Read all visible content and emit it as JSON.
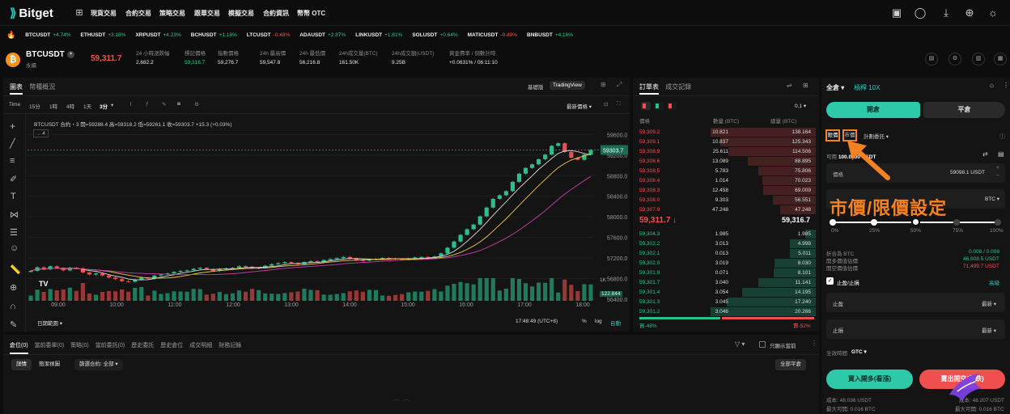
{
  "nav": {
    "brand": "Bitget",
    "items": [
      "現貨交易",
      "合約交易",
      "策略交易",
      "跟單交易",
      "模擬交易",
      "合約資訊",
      "幣幣 OTC"
    ]
  },
  "ticker": [
    {
      "sym": "BTCUSDT",
      "chg": "+4.74%",
      "dir": "up"
    },
    {
      "sym": "ETHUSDT",
      "chg": "+3.18%",
      "dir": "up"
    },
    {
      "sym": "XRPUSDT",
      "chg": "+4.23%",
      "dir": "up"
    },
    {
      "sym": "BCHUSDT",
      "chg": "+1.18%",
      "dir": "up"
    },
    {
      "sym": "LTCUSDT",
      "chg": "-0.48%",
      "dir": "dn"
    },
    {
      "sym": "ADAUSDT",
      "chg": "+2.87%",
      "dir": "up"
    },
    {
      "sym": "LINKUSDT",
      "chg": "+1.81%",
      "dir": "up"
    },
    {
      "sym": "SOLUSDT",
      "chg": "+0.64%",
      "dir": "up"
    },
    {
      "sym": "MATICUSDT",
      "chg": "-0.49%",
      "dir": "dn"
    },
    {
      "sym": "BNBUSDT",
      "chg": "+4.16%",
      "dir": "up"
    }
  ],
  "pair": {
    "name": "BTCUSDT",
    "type": "永續",
    "coin_letter": "₿",
    "price": "59,311.7",
    "stats": [
      {
        "label": "24 小時漲跌幅",
        "value": "2,682.2",
        "sub": "+4.74%"
      },
      {
        "label": "標記價格",
        "value": "59,316.7"
      },
      {
        "label": "指數價格",
        "value": "59,276.7"
      },
      {
        "label": "24h 最高價",
        "value": "59,547.8"
      },
      {
        "label": "24h 最低價",
        "value": "56,216.8"
      },
      {
        "label": "24h成交量(BTC)",
        "value": "161.50K"
      },
      {
        "label": "24h成交額(USDT)",
        "value": "9.25B"
      },
      {
        "label": "資金費率 / 倒數計時",
        "value": "+0.0631% / 06:11:10"
      }
    ]
  },
  "chart": {
    "tabs": [
      "圖表",
      "幣種概況"
    ],
    "modes": [
      "基礎版",
      "TradingView"
    ],
    "intervals": [
      "Time",
      "15分",
      "1時",
      "4時",
      "1天",
      "3分"
    ],
    "price_type": "最新價格",
    "legend": "BTCUSDT 合約・3  開=59288.4 高=59318.2 低=59261.1 收=59303.7 +15.3 (+0.03%)",
    "indicator_count": "4",
    "current_price_label": "59303.7",
    "volume_label": "122.844",
    "vol_axis_label": "1K",
    "time_display": "17:48:49 (UTC+8)",
    "date_range": "日期範圍",
    "pct": "%",
    "log": "log",
    "auto": "自動"
  },
  "chart_data": {
    "type": "candlestick",
    "y_ticks": [
      "59600.0",
      "59200.0",
      "58800.0",
      "58400.0",
      "58000.0",
      "57600.0",
      "57200.0",
      "56800.0",
      "56400.0"
    ],
    "ylim": [
      56400,
      59700
    ],
    "x_ticks": [
      "09:00",
      "10:00",
      "11:00",
      "12:00",
      "13:00",
      "14:00",
      "15:00",
      "16:00",
      "17:00",
      "18:00"
    ],
    "close": [
      56950,
      57020,
      56980,
      57040,
      57000,
      56960,
      57010,
      57000,
      56920,
      56880,
      56900,
      56860,
      56820,
      56790,
      56750,
      56740,
      56780,
      56820,
      56800,
      56860,
      56880,
      56900,
      56930,
      56950,
      56960,
      56990,
      57010,
      56980,
      56950,
      56990,
      57000,
      57010,
      57040,
      57030,
      57000,
      57010,
      57050,
      57080,
      57100,
      57120,
      57100,
      57080,
      57120,
      57140,
      57130,
      57160,
      57180,
      57200,
      57220,
      57190,
      57160,
      57150,
      57170,
      57180,
      57200,
      57190,
      57180,
      57170,
      57190,
      57210,
      57220,
      57210,
      57230,
      57290,
      57400,
      57520,
      57650,
      57760,
      57850,
      58010,
      58180,
      58350,
      58420,
      58500,
      58680,
      58840,
      58950,
      59020,
      59120,
      59210,
      59380,
      59430,
      59260,
      59150,
      59110,
      59210,
      59300
    ]
  },
  "orderbook": {
    "tabs": [
      "訂單表",
      "成交記錄"
    ],
    "precision": "0.1",
    "headers": [
      "價格",
      "數量 (BTC)",
      "總量 (BTC)"
    ],
    "asks": [
      [
        "59,309.2",
        "10.821",
        "138.164"
      ],
      [
        "59,309.1",
        "10.837",
        "125.343"
      ],
      [
        "59,308.9",
        "25.611",
        "114.506"
      ],
      [
        "59,308.6",
        "13.089",
        "88.895"
      ],
      [
        "59,308.5",
        "5.783",
        "75.806"
      ],
      [
        "59,308.4",
        "1.014",
        "70.023"
      ],
      [
        "59,308.3",
        "12.458",
        "69.009"
      ],
      [
        "59,308.0",
        "9.303",
        "56.551"
      ],
      [
        "59,307.9",
        "47.248",
        "47.248"
      ]
    ],
    "mid_price": "59,311.7 ↓",
    "mark": "59,316.7",
    "bids": [
      [
        "59,304.3",
        "1.985",
        "1.985"
      ],
      [
        "59,302.2",
        "3.013",
        "4.998"
      ],
      [
        "59,302.1",
        "0.013",
        "5.011"
      ],
      [
        "59,302.0",
        "3.019",
        "8.030"
      ],
      [
        "59,301.9",
        "0.071",
        "8.101"
      ],
      [
        "59,301.7",
        "3.040",
        "11.141"
      ],
      [
        "59,301.4",
        "3.054",
        "14.195"
      ],
      [
        "59,301.3",
        "3.045",
        "17.240"
      ],
      [
        "59,301.2",
        "3.046",
        "20.286"
      ]
    ],
    "buy_ratio": "買-48%",
    "sell_ratio": "賣-52%"
  },
  "trade": {
    "margin_mode": "全倉",
    "leverage": "槓桿 10X",
    "open": "開倉",
    "close": "平倉",
    "order_types": [
      "限價",
      "市價",
      "計劃委託"
    ],
    "avail_label": "可用",
    "avail_value": "100.0000 USDT",
    "price_label": "價格",
    "price_value": "59098.1 USDT",
    "qty_unit": "BTC",
    "annotation": "市價/限價設定",
    "slider": [
      "0%",
      "25%",
      "50%",
      "75%",
      "100%"
    ],
    "info": [
      [
        "折合為 BTC",
        "0.008 / 0.008"
      ],
      [
        "開多價值估價",
        "46,908.5 USDT"
      ],
      [
        "開空價值估價",
        "71,499.7 USDT"
      ]
    ],
    "tpsl": "止盈/止損",
    "advanced": "高級",
    "tp": "止盈",
    "sl": "止損",
    "latest": "最新",
    "tif_label": "生效時間",
    "tif": "GTC",
    "buy": "買入開多(看漲)",
    "sell": "賣出開空(看跌)",
    "cost_buy": "成本: 48.036 USDT",
    "cost_sell": "成本: 48.207 USDT",
    "max_buy": "最大可開: 0.016 BTC",
    "max_sell": "最大可開: 0.016 BTC"
  },
  "bottom": {
    "tabs": [
      "倉位(0)",
      "當前委單(0)",
      "策略(0)",
      "當前委託(0)",
      "歷史委託",
      "歷史倉位",
      "成交明細",
      "財務記錄"
    ],
    "show_current": "只顯示當前",
    "filters": [
      "詳情",
      "簡潔視圖",
      "篩選合約: 全部"
    ],
    "close_all": "全部平倉"
  },
  "colors": {
    "up": "#25c18e",
    "down": "#f0504d",
    "accent": "#1ecfc0",
    "annotation": "#f58220"
  }
}
